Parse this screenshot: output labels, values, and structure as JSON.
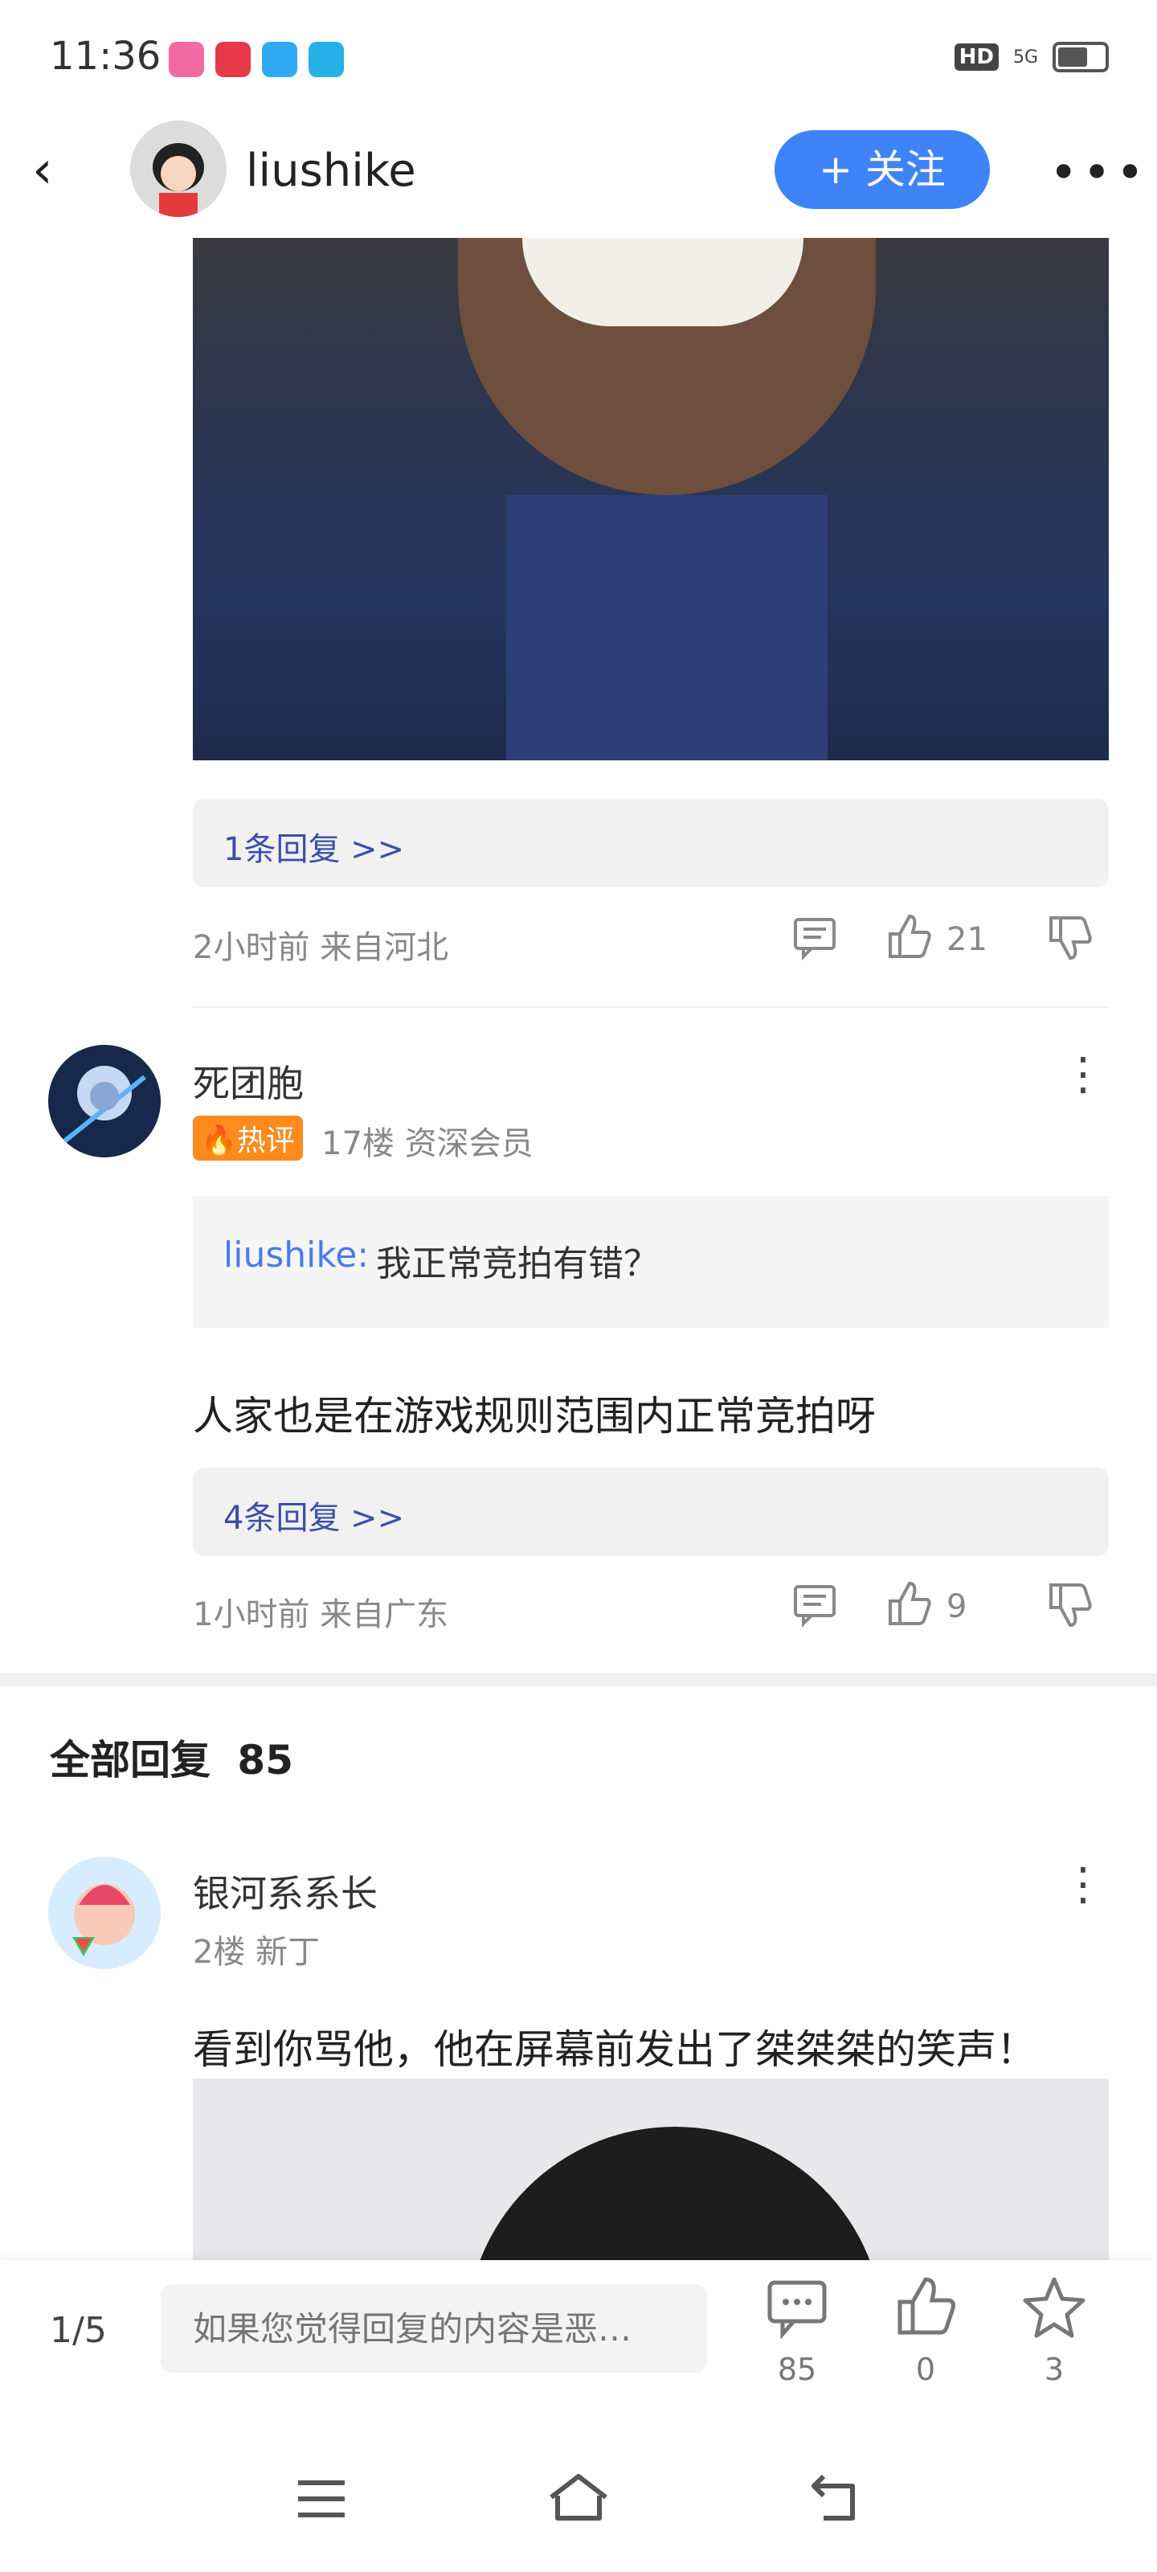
{
  "status_bar": {
    "time": "11:36",
    "hd": "HD",
    "network": "5G"
  },
  "header": {
    "back_icon": "back-arrow-icon",
    "username": "liushike",
    "follow_label": "+ 关注",
    "more_icon": "more-horizontal-icon"
  },
  "comment1": {
    "replies_link": "1条回复 >>",
    "meta": "2小时前 来自河北",
    "like_count": "21"
  },
  "comment2": {
    "name": "死团胞",
    "hot_badge": "🔥热评",
    "floor": "17楼 资深会员",
    "quote_user": "liushike:",
    "quote_text": "我正常竞拍有错？",
    "text": "人家也是在游戏规则范围内正常竞拍呀",
    "replies_link": "4条回复 >>",
    "meta": "1小时前 来自广东",
    "like_count": "9"
  },
  "all_replies": {
    "label": "全部回复",
    "count": "85"
  },
  "comment3": {
    "name": "银河系系长",
    "floor": "2楼 新丁",
    "text": "看到你骂他，他在屏幕前发出了桀桀桀的笑声！"
  },
  "bottom_bar": {
    "page": "1/5",
    "input_placeholder": "如果您觉得回复的内容是恶…",
    "comment_count": "85",
    "like_count": "0",
    "fav_count": "3"
  },
  "icons": {
    "comment": "comment-icon",
    "like": "thumbs-up-icon",
    "dislike": "thumbs-down-icon",
    "star": "star-icon",
    "menu": "menu-icon",
    "home": "home-icon",
    "back": "return-icon"
  }
}
